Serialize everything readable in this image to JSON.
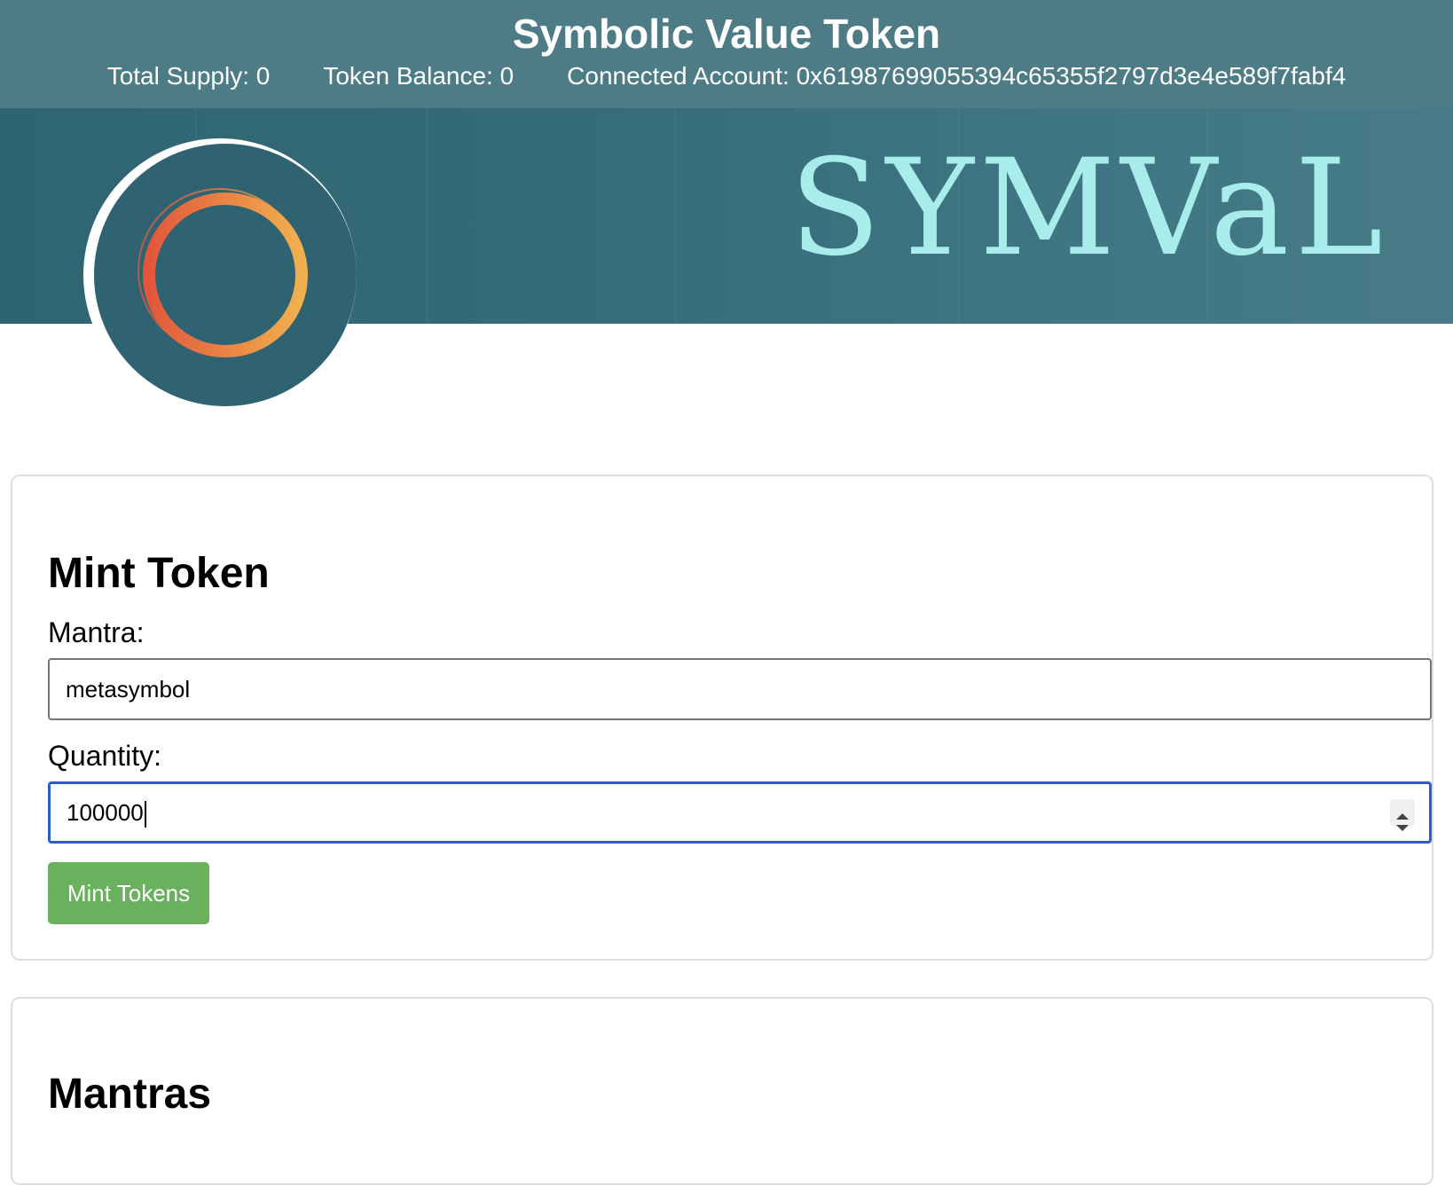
{
  "header": {
    "title": "Symbolic Value Token",
    "total_supply": "Total Supply: 0",
    "token_balance": "Token Balance: 0",
    "connected_account": "Connected Account: 0x61987699055394c65355f2797d3e4e589f7fabf4"
  },
  "banner": {
    "wordmark": "SYMVaL"
  },
  "mint": {
    "heading": "Mint Token",
    "mantra_label": "Mantra:",
    "mantra_value": "metasymbol",
    "quantity_label": "Quantity:",
    "quantity_value": "100000",
    "button_label": "Mint Tokens"
  },
  "mantras": {
    "heading": "Mantras"
  },
  "colors": {
    "header_bg": "#4e7c86",
    "banner_bg": "#356b77",
    "wordmark": "#a9ecec",
    "button": "#6ab15e",
    "focus_border": "#2d5dc7",
    "ring_start": "#e2573b",
    "ring_end": "#f0b04e"
  },
  "icons": {
    "logo": "ring-logo-icon",
    "spinner": "number-spinner-icon"
  }
}
